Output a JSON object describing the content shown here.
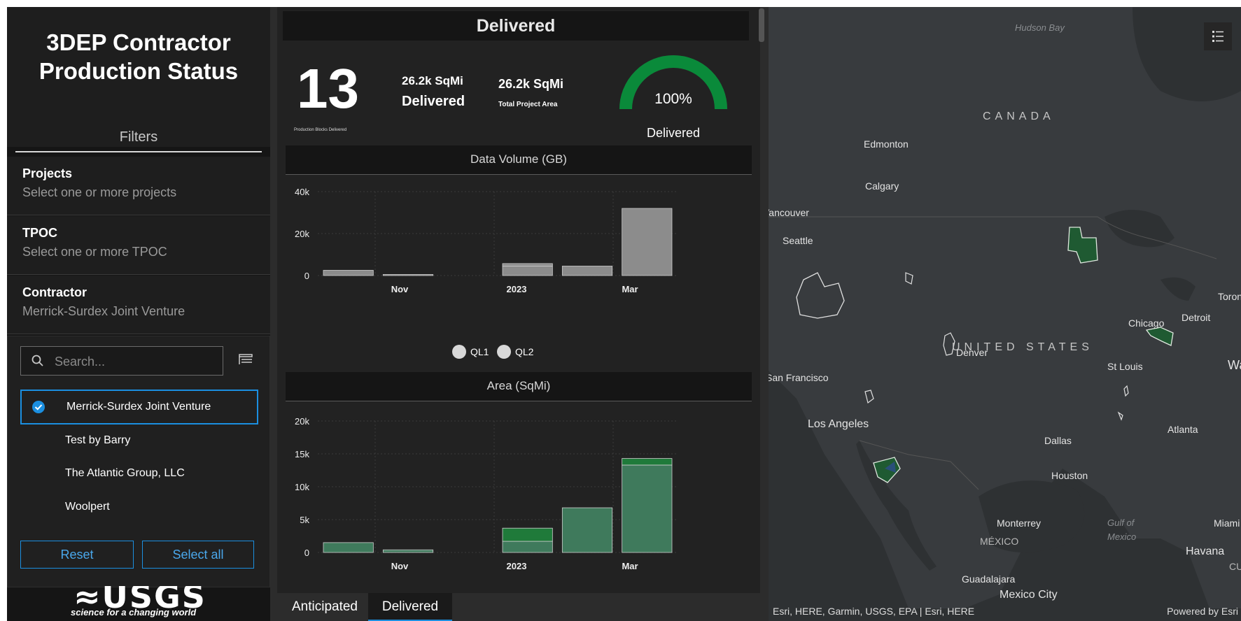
{
  "app": {
    "title_line1": "3DEP Contractor",
    "title_line2": "Production Status",
    "filters_label": "Filters"
  },
  "filters": {
    "projects": {
      "title": "Projects",
      "value": "Select one or more projects"
    },
    "tpoc": {
      "title": "TPOC",
      "value": "Select one or more TPOC"
    },
    "contractor": {
      "title": "Contractor",
      "value": "Merrick-Surdex Joint Venture"
    }
  },
  "dropdown": {
    "search_placeholder": "Search...",
    "options": [
      {
        "label": "Merrick-Surdex Joint Venture",
        "selected": true
      },
      {
        "label": "Test by Barry",
        "selected": false
      },
      {
        "label": "The Atlantic Group, LLC",
        "selected": false
      },
      {
        "label": "Woolpert",
        "selected": false
      }
    ],
    "reset_label": "Reset",
    "select_all_label": "Select all"
  },
  "logo": {
    "text": "≈USGS",
    "tagline": "science for a changing world"
  },
  "summary": {
    "header": "Delivered",
    "blocks_count": "13",
    "blocks_label": "Production Blocks Delivered",
    "delivered_area": "26.2k SqMi",
    "delivered_area_label": "Delivered",
    "total_area": "26.2k SqMi",
    "total_area_label": "Total Project Area",
    "gauge_percent": "100%",
    "gauge_value": 1.0,
    "gauge_label": "Delivered",
    "gauge_color": "#0a8a3a"
  },
  "chart_data": [
    {
      "type": "bar",
      "title": "Data Volume (GB)",
      "x_labels": [
        "Nov",
        "2023",
        "Mar"
      ],
      "y_ticks": [
        "40k",
        "20k",
        "0"
      ],
      "ylim": [
        0,
        40000
      ],
      "bar_color": "#8c8c8c",
      "series": [
        {
          "name": "QL1",
          "values": [
            2500,
            500,
            0,
            4500,
            4500,
            32000
          ]
        },
        {
          "name": "QL2",
          "values": [
            0,
            0,
            0,
            1200,
            0,
            0
          ]
        }
      ],
      "legend": [
        "QL1",
        "QL2"
      ]
    },
    {
      "type": "bar",
      "title": "Area (SqMi)",
      "x_labels": [
        "Nov",
        "2023",
        "Mar"
      ],
      "y_ticks": [
        "20k",
        "15k",
        "10k",
        "5k",
        "0"
      ],
      "ylim": [
        0,
        20000
      ],
      "series": [
        {
          "name": "QL1",
          "values": [
            1500,
            400,
            0,
            1700,
            6800,
            13300
          ],
          "color": "#3f7a5c"
        },
        {
          "name": "QL2",
          "values": [
            0,
            0,
            0,
            2000,
            0,
            1000
          ],
          "color": "#1f7a3a"
        }
      ]
    }
  ],
  "tabs": [
    {
      "label": "Anticipated",
      "active": false
    },
    {
      "label": "Delivered",
      "active": true
    }
  ],
  "map": {
    "labels": {
      "hudson": "Hudson Bay",
      "canada": "CANADA",
      "edmonton": "Edmonton",
      "calgary": "Calgary",
      "vancouver": "Vancouver",
      "seattle": "Seattle",
      "united_states": "UNITED STATES",
      "chicago": "Chicago",
      "detroit": "Detroit",
      "toronto": "Toronto",
      "denver": "Denver",
      "st_louis": "St Louis",
      "san_francisco": "San Francisco",
      "los_angeles": "Los Angeles",
      "dallas": "Dallas",
      "atlanta": "Atlanta",
      "houston": "Houston",
      "monterrey": "Monterrey",
      "mexico": "MÉXICO",
      "gulf": "Gulf of",
      "gulf2": "Mexico",
      "miami": "Miami",
      "havana": "Havana",
      "guadalajara": "Guadalajara",
      "mexico_city": "Mexico City",
      "wa": "Wa",
      "cu": "CU"
    },
    "attribution": "Esri, HERE, Garmin, USGS, EPA | Esri, HERE",
    "powered_by": "Powered by Esri"
  }
}
